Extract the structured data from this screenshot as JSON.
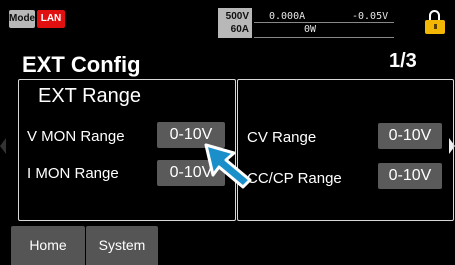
{
  "status_bar": {
    "mode_label": "Mode",
    "lan_label": "LAN",
    "voltage_rating": "500V",
    "current_rating": "60A",
    "current_reading": "0.000A",
    "voltage_reading": "-0.05V",
    "power_reading": "0W",
    "lock_icon": "lock-icon"
  },
  "page": {
    "title": "EXT Config",
    "page_indicator": "1/3"
  },
  "left_panel": {
    "title": "EXT Range",
    "rows": [
      {
        "label": "V MON Range",
        "value": "0-10V"
      },
      {
        "label": "I MON Range",
        "value": "0-10V"
      }
    ]
  },
  "right_panel": {
    "rows": [
      {
        "label": "CV Range",
        "value": "0-10V"
      },
      {
        "label": "CC/CP Range",
        "value": "0-10V"
      }
    ]
  },
  "tabs": [
    {
      "label": "Home"
    },
    {
      "label": "System"
    }
  ],
  "colors": {
    "background": "#000000",
    "lan_badge": "#e01010",
    "lock_body": "#f2b705",
    "value_button": "#5a5a5a",
    "cursor": "#1a8fc9"
  }
}
